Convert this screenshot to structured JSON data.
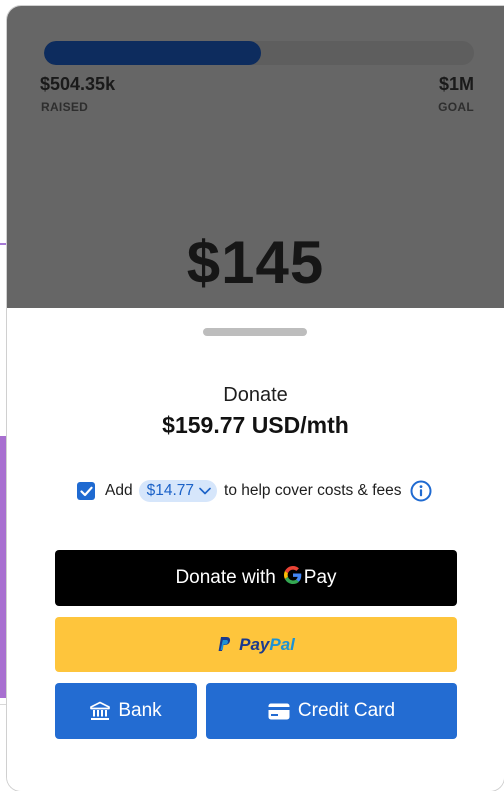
{
  "campaign": {
    "raised_amount": "$504.35k",
    "raised_label": "RAISED",
    "goal_amount": "$1M",
    "goal_label": "GOAL",
    "progress_fraction": 0.504,
    "selected_amount": "$145"
  },
  "donate": {
    "label": "Donate",
    "amount_text": "$159.77 USD/mth"
  },
  "fee": {
    "checked": true,
    "prefix": "Add",
    "amount": "$14.77",
    "suffix": "to help cover costs & fees"
  },
  "buttons": {
    "gpay_label": "Donate with",
    "gpay_g": "G",
    "gpay_pay": "Pay",
    "paypal_part1": "Pay",
    "paypal_part2": "Pal",
    "bank_label": "Bank",
    "credit_card_label": "Credit Card"
  },
  "colors": {
    "overlay": "#666666",
    "progress_fill": "#0d2c5e",
    "primary_blue": "#236cd2",
    "paypal_yellow": "#fec53c",
    "gpay_black": "#000000"
  }
}
